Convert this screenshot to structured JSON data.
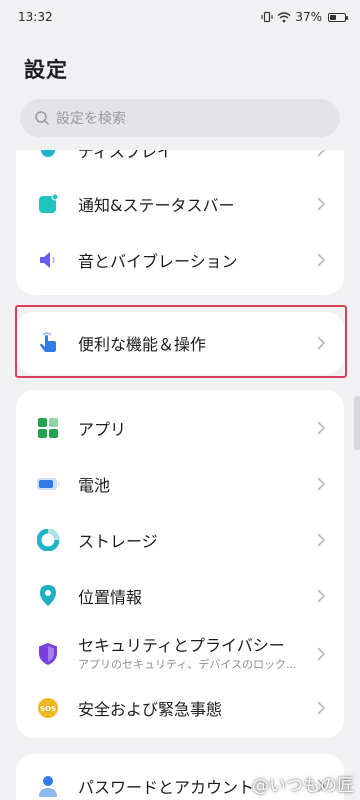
{
  "status_bar": {
    "time": "13:32",
    "battery_percent": "37%",
    "battery_level": 0.37
  },
  "header": {
    "title": "設定"
  },
  "search": {
    "placeholder": "設定を検索",
    "icon": "search-icon"
  },
  "card1": {
    "items": [
      {
        "label": "ディスプレイ",
        "icon": "display-icon",
        "color": "#1fb5c8"
      },
      {
        "label": "通知&ステータスバー",
        "icon": "notification-icon",
        "color": "#1fc4c0"
      },
      {
        "label": "音とバイブレーション",
        "icon": "speaker-icon",
        "color": "#6b5cf0"
      }
    ]
  },
  "card2": {
    "items": [
      {
        "label": "便利な機能＆操作",
        "icon": "touch-gesture-icon",
        "color": "#2f7be8"
      }
    ]
  },
  "card3": {
    "items": [
      {
        "label": "アプリ",
        "icon": "apps-grid-icon",
        "color": "#22a34d"
      },
      {
        "label": "電池",
        "icon": "battery-icon",
        "color": "#2f7be8"
      },
      {
        "label": "ストレージ",
        "icon": "storage-pie-icon",
        "color": "#1fb5c8"
      },
      {
        "label": "位置情報",
        "icon": "location-pin-icon",
        "color": "#1fb0c0"
      },
      {
        "label": "セキュリティとプライバシー",
        "sublabel": "アプリのセキュリティ、デバイスのロック...",
        "icon": "shield-icon",
        "color": "#7a3fe0"
      },
      {
        "label": "安全および緊急事態",
        "icon": "sos-icon",
        "color": "#f0b61f"
      }
    ]
  },
  "card4": {
    "items": [
      {
        "label": "パスワードとアカウント",
        "icon": "account-icon",
        "color": "#2f7be8"
      }
    ]
  },
  "watermark": "@いつもの匠"
}
